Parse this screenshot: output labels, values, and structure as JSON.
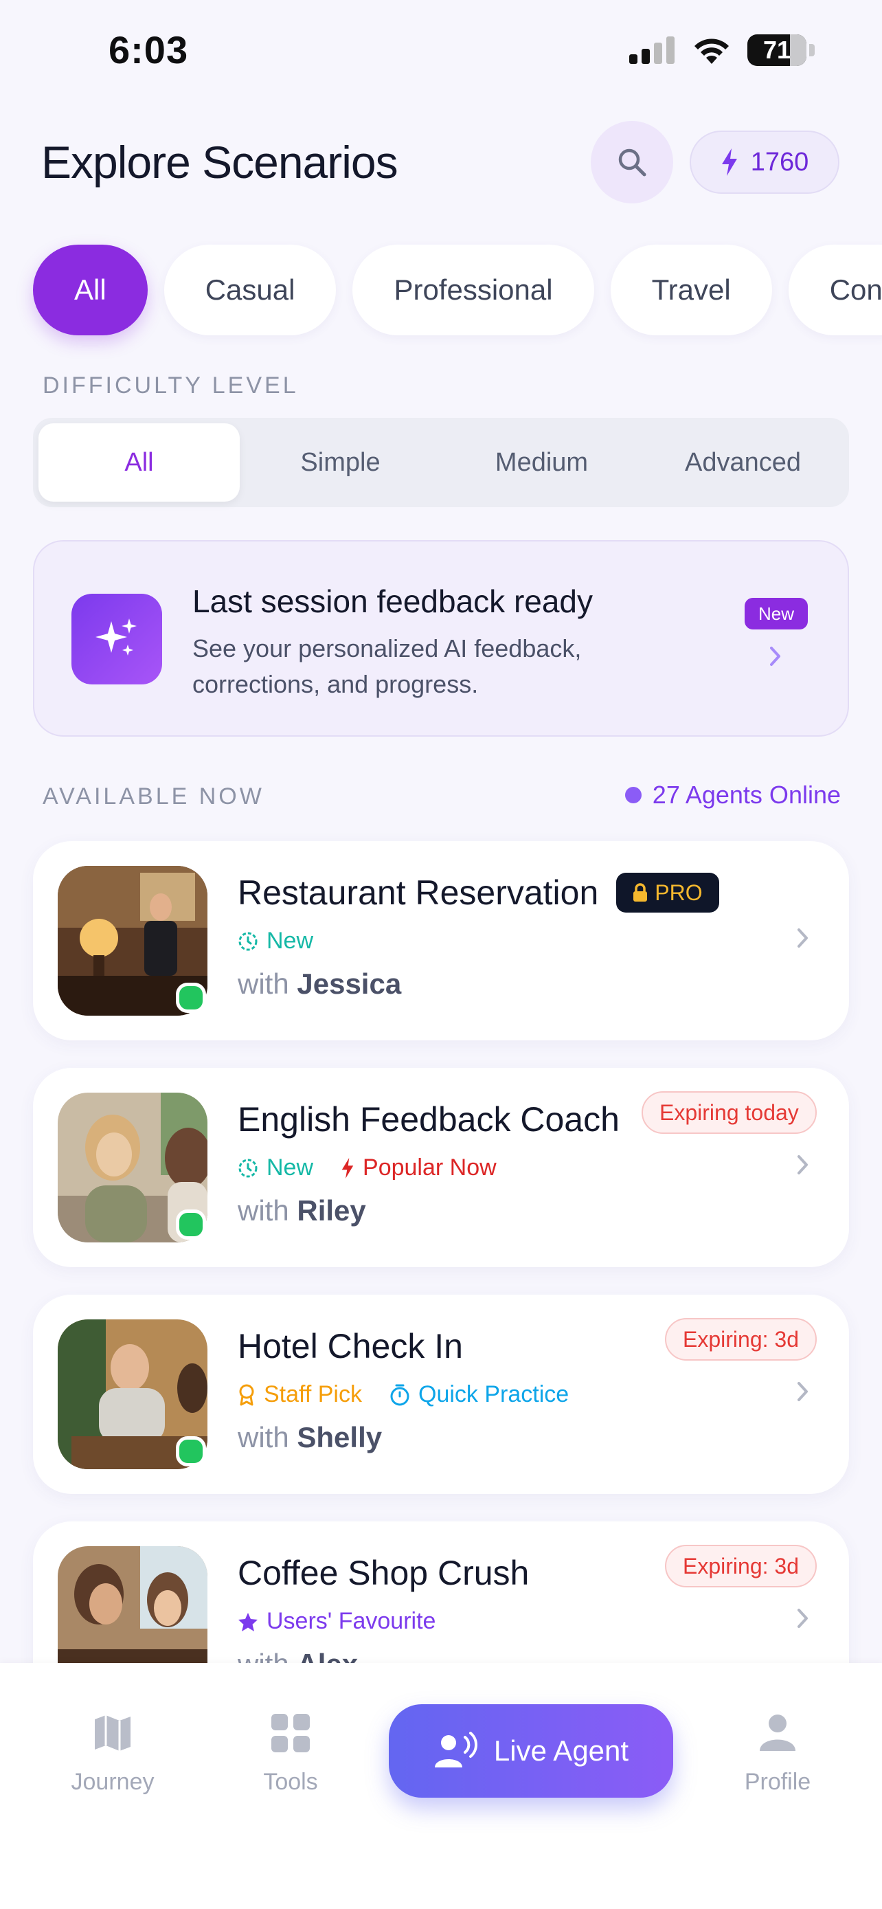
{
  "status_bar": {
    "time": "6:03",
    "battery": "71"
  },
  "header": {
    "title": "Explore Scenarios",
    "points": "1760"
  },
  "categories": [
    "All",
    "Casual",
    "Professional",
    "Travel",
    "Con"
  ],
  "difficulty": {
    "label": "DIFFICULTY LEVEL",
    "options": [
      "All",
      "Simple",
      "Medium",
      "Advanced"
    ],
    "selected": "All"
  },
  "feedback_banner": {
    "title": "Last session feedback ready",
    "body_line1": "See your personalized AI feedback,",
    "body_line2": "corrections, and progress.",
    "badge": "New"
  },
  "available": {
    "label": "AVAILABLE NOW",
    "online_text": "27 Agents Online"
  },
  "scenarios": [
    {
      "title": "Restaurant Reservation",
      "badge": "PRO",
      "tags": [
        "New"
      ],
      "with_prefix": "with",
      "agent": "Jessica"
    },
    {
      "title": "English Feedback Coach",
      "badge": "Expiring today",
      "tags": [
        "New",
        "Popular Now"
      ],
      "with_prefix": "with",
      "agent": "Riley"
    },
    {
      "title": "Hotel Check In",
      "badge": "Expiring: 3d",
      "tags": [
        "Staff Pick",
        "Quick Practice"
      ],
      "with_prefix": "with",
      "agent": "Shelly"
    },
    {
      "title": "Coffee Shop Crush",
      "badge": "Expiring: 3d",
      "tags": [
        "Users' Favourite"
      ],
      "with_prefix": "with",
      "agent": "Alex"
    }
  ],
  "bottom_nav": {
    "journey": "Journey",
    "tools": "Tools",
    "live_agent": "Live Agent",
    "profile": "Profile"
  },
  "colors": {
    "accent": "#8B2CE0",
    "online": "#22C55E",
    "new_tag": "#14B8A6",
    "popular": "#DC2626",
    "staff_pick": "#F59E0B",
    "quick_practice": "#0EA5E9",
    "favourite": "#7C3AED"
  }
}
